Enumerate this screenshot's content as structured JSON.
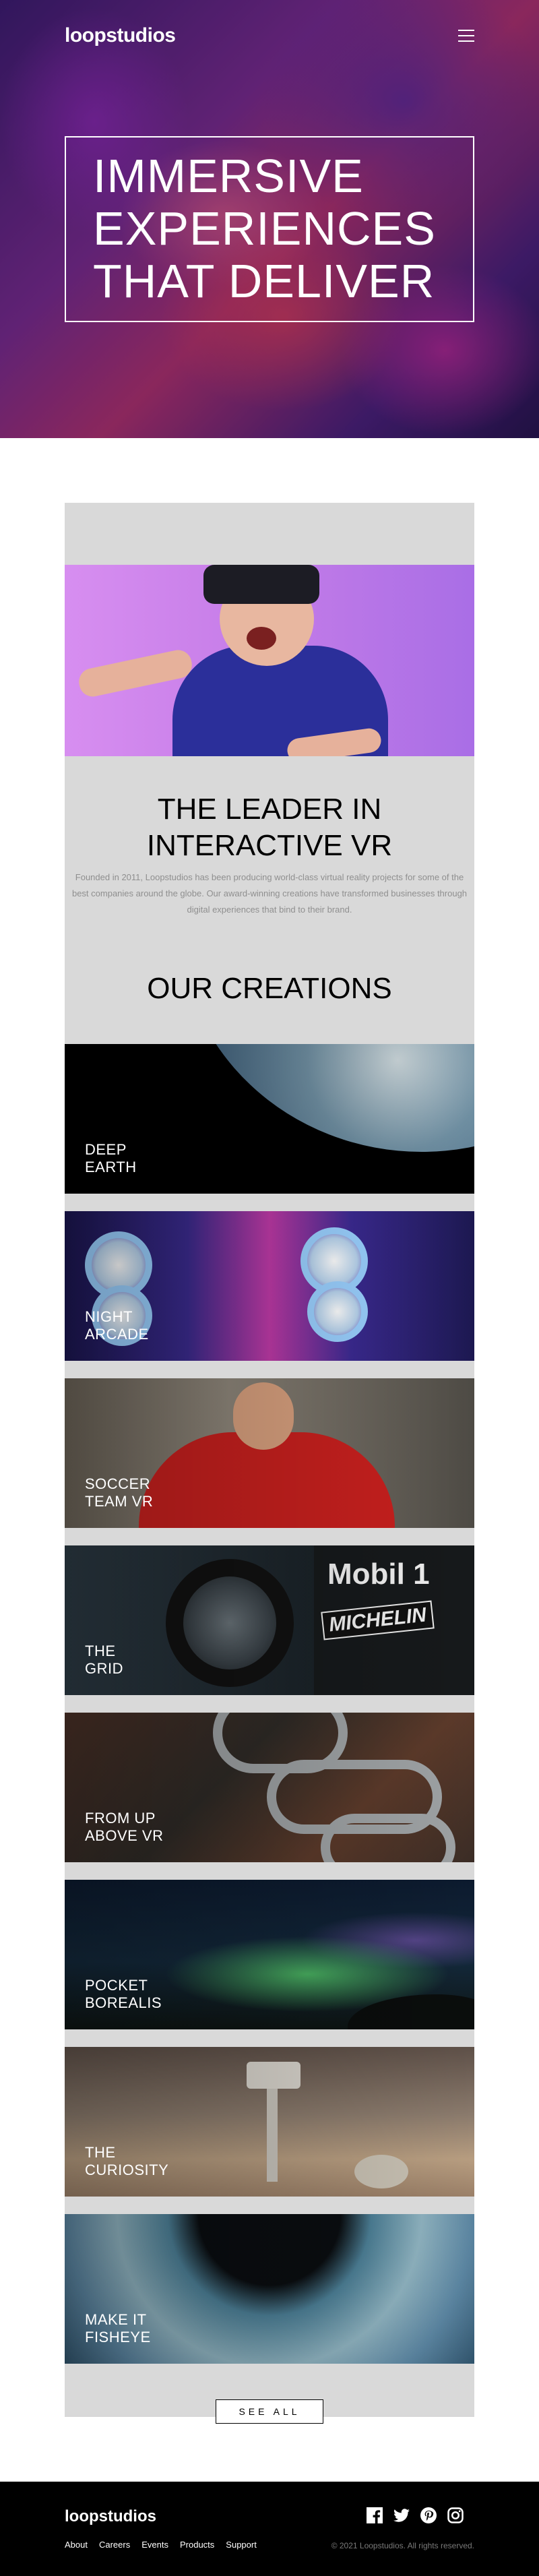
{
  "header": {
    "logo": "loopstudios",
    "menu_icon": "hamburger-menu-icon"
  },
  "hero": {
    "title": "IMMERSIVE\nEXPERIENCES\nTHAT DELIVER"
  },
  "about": {
    "title": "THE LEADER IN\nINTERACTIVE VR",
    "text": "Founded in 2011, Loopstudios has been producing world-class virtual reality projects for some of the best companies around the globe. Our award-winning creations have transformed businesses through digital experiences that bind to their brand."
  },
  "creations": {
    "title": "OUR CREATIONS",
    "items": [
      {
        "label": "DEEP\nEARTH"
      },
      {
        "label": "NIGHT\nARCADE"
      },
      {
        "label": "SOCCER\nTEAM VR"
      },
      {
        "label": "THE\nGRID"
      },
      {
        "label": "FROM UP\nABOVE VR"
      },
      {
        "label": "POCKET\nBOREALIS"
      },
      {
        "label": "THE\nCURIOSITY"
      },
      {
        "label": "MAKE IT\nFISHEYE"
      }
    ],
    "see_all": "SEE ALL"
  },
  "footer": {
    "logo": "loopstudios",
    "nav": [
      "About",
      "Careers",
      "Events",
      "Products",
      "Support"
    ],
    "socials": [
      "facebook-icon",
      "twitter-icon",
      "pinterest-icon",
      "instagram-icon"
    ],
    "copyright": "© 2021 Loopstudios. All rights reserved."
  }
}
